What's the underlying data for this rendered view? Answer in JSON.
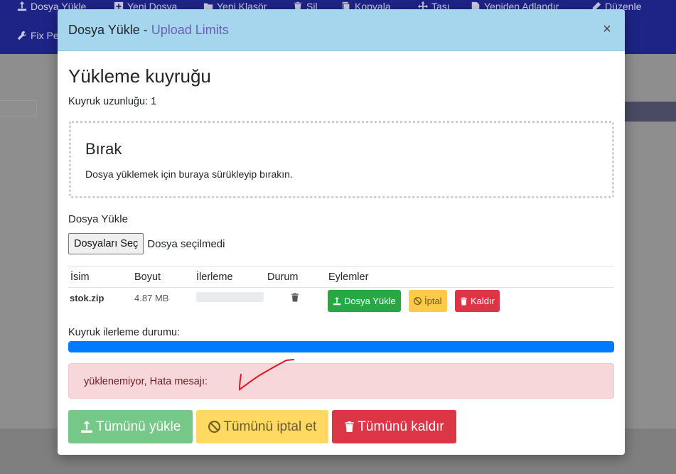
{
  "toolbar": {
    "items": [
      {
        "label": "Dosya Yükle",
        "icon": "upload-icon"
      },
      {
        "label": "Yeni Dosya",
        "icon": "plus-icon"
      },
      {
        "label": "Yeni Klasör",
        "icon": "folder-icon"
      },
      {
        "label": "Sil",
        "icon": "trash-icon"
      },
      {
        "label": "Kopyala",
        "icon": "copy-icon"
      },
      {
        "label": "Taşı",
        "icon": "move-icon"
      },
      {
        "label": "Yeniden Adlandır",
        "icon": "rename-icon"
      },
      {
        "label": "Düzenle",
        "icon": "edit-icon"
      },
      {
        "label": "Fix Pe",
        "icon": "wrench-icon"
      }
    ]
  },
  "modal": {
    "title_prefix": "Dosya Yükle - ",
    "title_link": "Upload Limits",
    "close_symbol": "×",
    "queue_title": "Yükleme kuyruğu",
    "queue_length": "Kuyruk uzunluğu: 1",
    "dropzone": {
      "title": "Bırak",
      "text": "Dosya yüklemek için buraya sürükleyip bırakın."
    },
    "upload_label": "Dosya Yükle",
    "file_button": "Dosyaları Seç",
    "file_status": "Dosya seçilmedi",
    "table": {
      "headers": [
        "İsim",
        "Boyut",
        "İlerleme",
        "Durum",
        "Eylemler"
      ],
      "rows": [
        {
          "name": "stok.zip",
          "size": "4.87 MB",
          "progress": 0,
          "actions": {
            "upload": "Dosya Yükle",
            "cancel": "İptal",
            "remove": "Kaldır"
          }
        }
      ]
    },
    "queue_progress_label": "Kuyruk ilerleme durumu:",
    "queue_progress": 100,
    "alert_text": "yüklenemiyor, Hata mesajı:",
    "footer": {
      "upload_all": "Tümünü yükle",
      "cancel_all": "Tümünü iptal et",
      "remove_all": "Tümünü kaldır"
    }
  },
  "colors": {
    "header_bg": "#a5d6ee",
    "success": "#28a745",
    "warning": "#ffc94a",
    "danger": "#dc3545",
    "progress": "#007bff",
    "alert_bg": "#f8d7da"
  }
}
